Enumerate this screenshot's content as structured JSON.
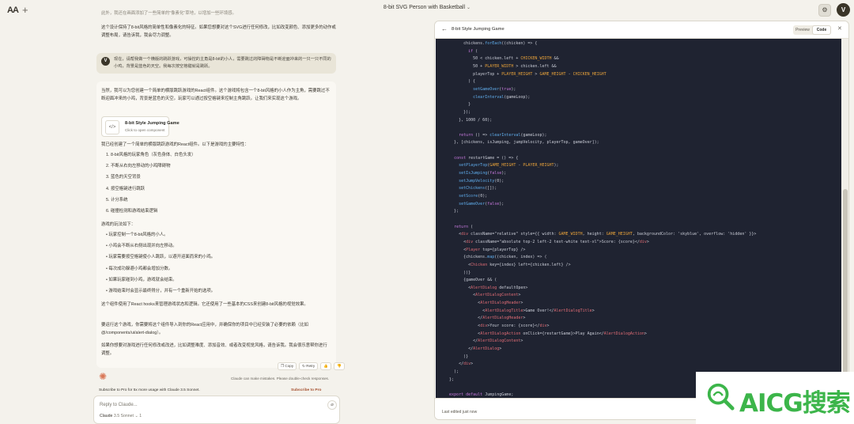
{
  "app": {
    "logo": "AA",
    "new_chat": "+",
    "title": "8-bit SVG Person with Basketball",
    "avatar_letter": "V"
  },
  "chat": {
    "faded_top": "此外，我还在画面添加了一些简单的\"像素化\"草地，以增加一些环境感。",
    "intro": "这个设计保持了8-bit风格的简单性和像素化的特征。如果您想要对这个SVG进行任何修改，比如改变颜色、添加更多的动作或调整布局，请告诉我，我会尽力调整。",
    "user_avatar": "V",
    "user_message": "现在，请帮我做一个横版的跳跃游戏，可操控的主角是8-bit的小人，需要跳过的障碍物是不断迎面冲来的一只一只不同的小鸡，背景是蓝色的天空。我每次按空格键就是跳跃。",
    "reply_intro": "当然，我可以为您创建一个简单的横版跳跃游戏的React组件。这个游戏将包含一个8-bit风格的小人作为主角，需要跳过不断迎面冲来的小鸡，背景是蓝色的天空。玩家可以通过按空格键来控制主角跳跃。让我们来实现这个游戏。",
    "artifact_title": "8-bit Style Jumping Game",
    "artifact_subtitle": "Click to open component",
    "features_intro": "我已经创建了一个简单的横版跳跃游戏的React组件。以下是游戏的主要特性：",
    "features": [
      "1. 8-bit风格的玩家角色（灰色身体、白色头发）",
      "2. 不断从右向左移动的小鸡障碍物",
      "3. 蓝色的天空背景",
      "4. 按空格键进行跳跃",
      "5. 计分系统",
      "6. 碰撞检测和游戏结束逻辑"
    ],
    "howto_intro": "游戏的玩法如下：",
    "howto": [
      "• 玩家控制一个8-bit风格的小人。",
      "• 小鸡会不断从右侧出现并向左移动。",
      "• 玩家需要按空格键使小人跳跃，以避开迎面而来的小鸡。",
      "• 每次成功躲避小鸡都会增加分数。",
      "• 如果玩家碰到小鸡，游戏就会结束。",
      "• 游戏结束时会显示最终得分，并有一个重新开始的选项。"
    ],
    "tech_note": "这个组件使用了React hooks来管理游戏状态和逻辑。它还使用了一些基本的CSS来创建8-bit风格的视觉效果。",
    "usage_note": "要运行这个游戏，你需要将这个组件导入到你的React应用中，并确保你的项目中已经安装了必要的依赖（比如@/components/ui/alert-dialog）。",
    "closing": "如果你想要对游戏进行任何修改或改进，比如调整难度、添加音效、或者改变视觉风格，请告诉我。我会很乐意帮你进行调整。",
    "actions": {
      "copy": "❐ Copy",
      "retry": "↻ Retry",
      "thumbs_up": "👍",
      "thumbs_down": "👎"
    },
    "disclaimer": "Claude can make mistakes. Please double-check responses.",
    "pro_banner": "Subscribe to Pro for 5x more usage with Claude 3.5 Sonnet.",
    "pro_link": "Subscribe to Pro",
    "composer_placeholder": "Reply to Claude...",
    "model": "Claude",
    "model_version": "3.5 Sonnet",
    "model_count": "1"
  },
  "artifact": {
    "back": "←",
    "title": "8-bit Style Jumping Game",
    "preview_label": "Preview",
    "code_label": "Code",
    "close": "✕",
    "footer": "Last edited just now",
    "code_lines": [
      "          chickens.forEach((chicken) => {",
      "            if (",
      "              50 < chicken.left + CHICKEN_WIDTH &&",
      "              50 + PLAYER_WIDTH > chicken.left &&",
      "              playerTop + PLAYER_HEIGHT > GAME_HEIGHT - CHICKEN_HEIGHT",
      "            ) {",
      "              setGameOver(true);",
      "              clearInterval(gameLoop);",
      "            }",
      "          });",
      "        }, 1000 / 60);",
      "",
      "        return () => clearInterval(gameLoop);",
      "      }, [chickens, isJumping, jumpVelocity, playerTop, gameOver]);",
      "",
      "      const restartGame = () => {",
      "        setPlayerTop(GAME_HEIGHT - PLAYER_HEIGHT);",
      "        setIsJumping(false);",
      "        setJumpVelocity(0);",
      "        setChickens([]);",
      "        setScore(0);",
      "        setGameOver(false);",
      "      };",
      "",
      "      return (",
      "        <div className=\"relative\" style={{ width: GAME_WIDTH, height: GAME_HEIGHT, backgroundColor: 'skyblue', overflow: 'hidden' }}>",
      "          <div className=\"absolute top-2 left-2 text-white text-xl\">Score: {score}</div>",
      "          <Player top={playerTop} />",
      "          {chickens.map((chicken, index) => (",
      "            <Chicken key={index} left={chicken.left} />",
      "          ))}",
      "          {gameOver && (",
      "            <AlertDialog defaultOpen>",
      "              <AlertDialogContent>",
      "                <AlertDialogHeader>",
      "                  <AlertDialogTitle>Game Over!</AlertDialogTitle>",
      "                </AlertDialogHeader>",
      "                <div>Your score: {score}</div>",
      "                <AlertDialogAction onClick={restartGame}>Play Again</AlertDialogAction>",
      "              </AlertDialogContent>",
      "            </AlertDialog>",
      "          )}",
      "        </div>",
      "      );",
      "    };",
      "",
      "    export default JumpingGame;"
    ]
  },
  "watermark": {
    "text": "AICG搜索",
    "color": "#3cb54a"
  },
  "colors": {
    "background": "#f4f2ec",
    "code_bg": "#1f2331",
    "accent": "#d97757",
    "keyword": "#c678dd",
    "identifier": "#e8a23a",
    "plain": "#c9ccd6",
    "tag": "#e06c75"
  }
}
